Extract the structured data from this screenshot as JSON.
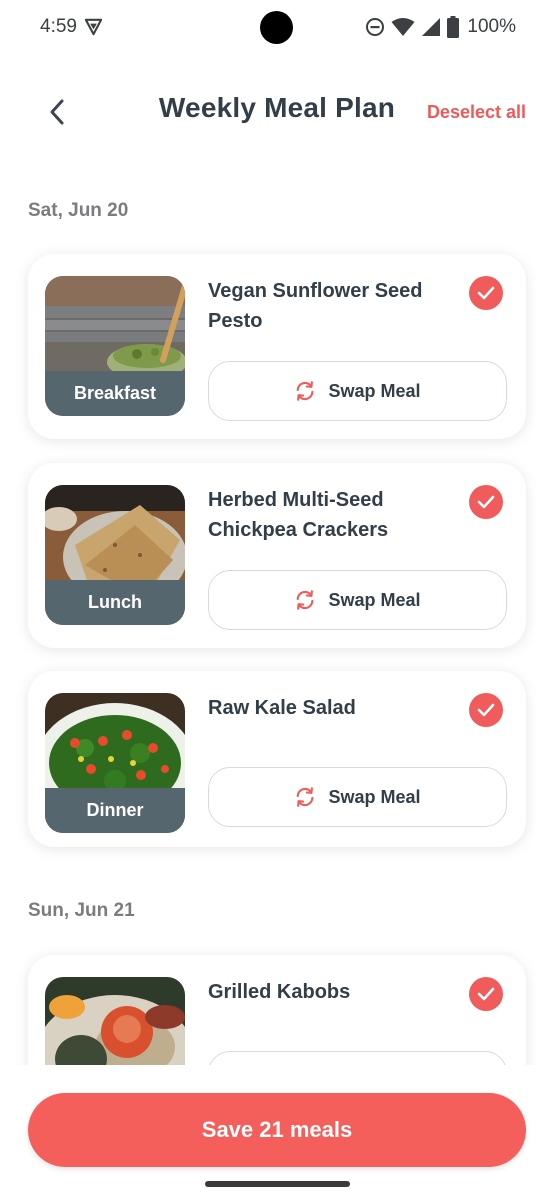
{
  "status_bar": {
    "time": "4:59",
    "battery": "100%"
  },
  "header": {
    "title": "Weekly Meal Plan",
    "deselect_label": "Deselect all"
  },
  "days": [
    {
      "label": "Sat, Jun 20",
      "meals": [
        {
          "type": "Breakfast",
          "name": "Vegan Sunflower Seed Pesto",
          "swap_label": "Swap Meal",
          "selected": true
        },
        {
          "type": "Lunch",
          "name": "Herbed Multi-Seed Chickpea Crackers",
          "swap_label": "Swap Meal",
          "selected": true
        },
        {
          "type": "Dinner",
          "name": "Raw Kale Salad",
          "swap_label": "Swap Meal",
          "selected": true
        }
      ]
    },
    {
      "label": "Sun, Jun 21",
      "meals": [
        {
          "name": "Grilled Kabobs",
          "selected": true
        }
      ]
    }
  ],
  "footer": {
    "save_label": "Save 21 meals"
  },
  "colors": {
    "accent": "#f45f5c",
    "tag_bg": "#56666e",
    "text": "#323e48"
  }
}
